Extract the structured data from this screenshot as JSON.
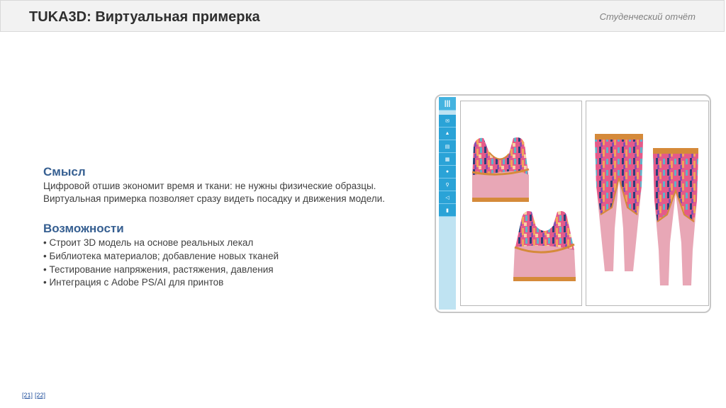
{
  "header": {
    "title": "TUKA3D: Виртуальная примерка",
    "subtitle": "Студенческий отчёт"
  },
  "meaning": {
    "heading": "Смысл",
    "lines": [
      "Цифровой отшив экономит время и ткани: не нужны физические образцы.",
      "Виртуальная примерка позволяет сразу видеть посадку и движения модели."
    ]
  },
  "features": {
    "heading": "Возможности",
    "items": [
      "• Строит 3D модель на основе реальных лекал",
      "• Библиотека материалов; добавление новых тканей",
      "• Тестирование напряжения, растяжения, давления",
      "• Интеграция с Adobe PS/AI для принтов"
    ]
  },
  "footer": {
    "ref1": "[21]",
    "ref2": "[22]"
  },
  "app": {
    "menu_glyph": "|||",
    "tools": [
      "mail-icon",
      "person-icon",
      "document-icon",
      "clipboard-icon",
      "settings-icon",
      "search-icon",
      "share-icon",
      "chart-icon"
    ],
    "tool_glyphs": [
      "✉",
      "▲",
      "▤",
      "▦",
      "●",
      "⚲",
      "◁",
      "▮"
    ],
    "colors": {
      "toolbar": "#2aa3d7",
      "toolbar_bg": "#bfe3f2",
      "garment_pink": "#e8a7b6",
      "trim_orange": "#d58a3a"
    }
  }
}
